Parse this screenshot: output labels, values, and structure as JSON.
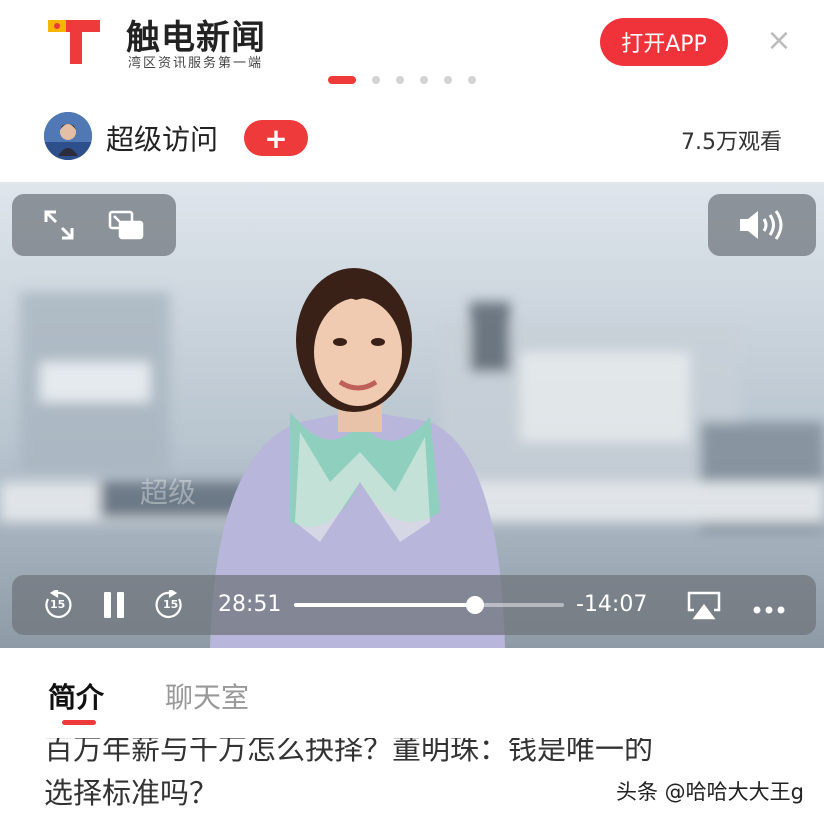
{
  "header": {
    "brand_name": "触电新闻",
    "brand_tagline": "湾区资讯服务第一端",
    "open_app_label": "打开APP",
    "close_icon": "close-icon",
    "page_dots": {
      "count": 6,
      "active_index": 0
    }
  },
  "channel": {
    "name": "超级访问",
    "follow_label": "+",
    "views": "7.5万观看"
  },
  "player": {
    "top_left_icons": [
      "expand-icon",
      "picture-in-picture-icon"
    ],
    "volume_icon": "volume-icon",
    "rewind_label": "15",
    "forward_label": "15",
    "elapsed": "28:51",
    "remaining": "-14:07",
    "progress": 0.67,
    "controls_icons": [
      "rewind-15-icon",
      "pause-icon",
      "forward-15-icon",
      "airplay-icon",
      "more-icon"
    ]
  },
  "tabs": [
    {
      "label": "简介",
      "active": true
    },
    {
      "label": "聊天室",
      "active": false
    }
  ],
  "article": {
    "title_line1": "百万年薪与千万怎么抉择？董明珠：钱是唯一的",
    "title_line2": "选择标准吗？"
  },
  "watermark": "头条 @哈哈大大王g",
  "colors": {
    "accent": "#ee3a3a",
    "logo_yellow": "#f7b500",
    "logo_red": "#ee3a3a"
  }
}
